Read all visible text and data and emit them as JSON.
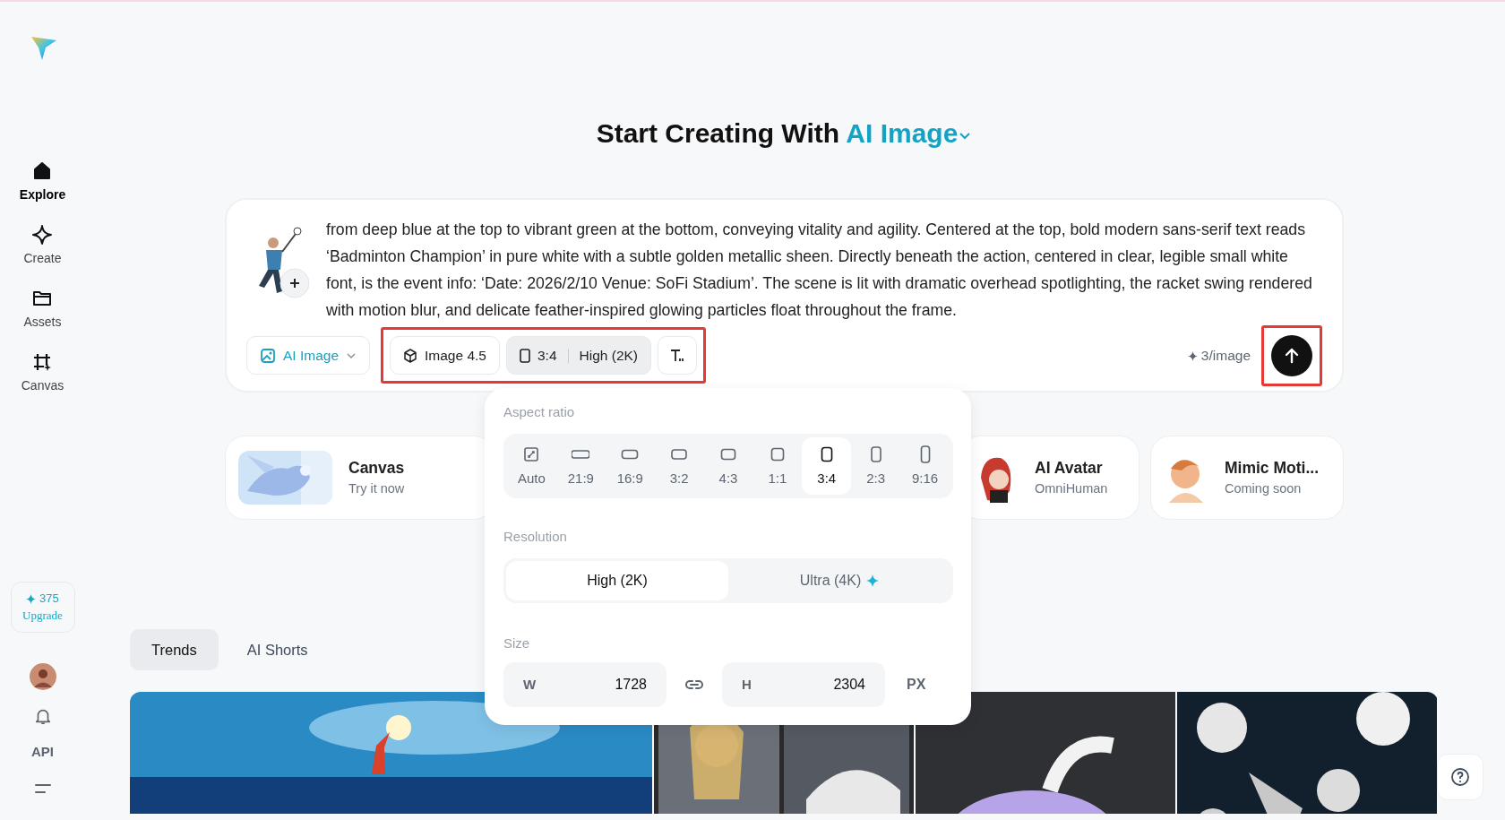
{
  "sidebar": {
    "nav_items": [
      {
        "label": "Explore",
        "selected": true
      },
      {
        "label": "Create",
        "selected": false
      },
      {
        "label": "Assets",
        "selected": false
      },
      {
        "label": "Canvas",
        "selected": false
      }
    ],
    "credits": "375",
    "upgrade": "Upgrade",
    "api": "API"
  },
  "heading": {
    "text": "Start Creating With",
    "mode": "AI Image"
  },
  "prompt": {
    "text": "from deep blue at the top to vibrant green at the bottom, conveying vitality and agility. Centered at the top, bold modern sans-serif text reads ‘Badminton Champion’ in pure white with a subtle golden metallic sheen. Directly beneath the action, centered in clear, legible small white font, is the event info: ‘Date: 2026/2/10 Venue: SoFi Stadium’. The scene is lit with dramatic overhead spotlighting, the racket swing rendered with motion blur, and delicate feather-inspired glowing particles float throughout the frame.",
    "tool": "AI Image",
    "model": "Image 4.5",
    "ratio": "3:4",
    "resolution": "High (2K)",
    "settings_highlighted": true,
    "cost": "3/image",
    "send_highlighted": true
  },
  "popup": {
    "aspect_label": "Aspect ratio",
    "ratios": [
      {
        "label": "Auto",
        "selected": false
      },
      {
        "label": "21:9",
        "selected": false
      },
      {
        "label": "16:9",
        "selected": false
      },
      {
        "label": "3:2",
        "selected": false
      },
      {
        "label": "4:3",
        "selected": false
      },
      {
        "label": "1:1",
        "selected": false
      },
      {
        "label": "3:4",
        "selected": true
      },
      {
        "label": "2:3",
        "selected": false
      },
      {
        "label": "9:16",
        "selected": false
      }
    ],
    "resolution_label": "Resolution",
    "resolutions": [
      {
        "label": "High (2K)",
        "selected": true,
        "premium": false
      },
      {
        "label": "Ultra (4K)",
        "selected": false,
        "premium": true
      }
    ],
    "size_label": "Size",
    "width": {
      "label": "W",
      "value": "1728"
    },
    "height": {
      "label": "H",
      "value": "2304"
    },
    "unit": "PX"
  },
  "features": [
    {
      "title": "Canvas",
      "subtitle": "Try it now"
    },
    {
      "title": "AI Avatar",
      "subtitle": "OmniHuman"
    },
    {
      "title": "Mimic Moti...",
      "subtitle": "Coming soon"
    }
  ],
  "tabs": [
    {
      "label": "Trends",
      "selected": true
    },
    {
      "label": "AI Shorts",
      "selected": false
    }
  ]
}
